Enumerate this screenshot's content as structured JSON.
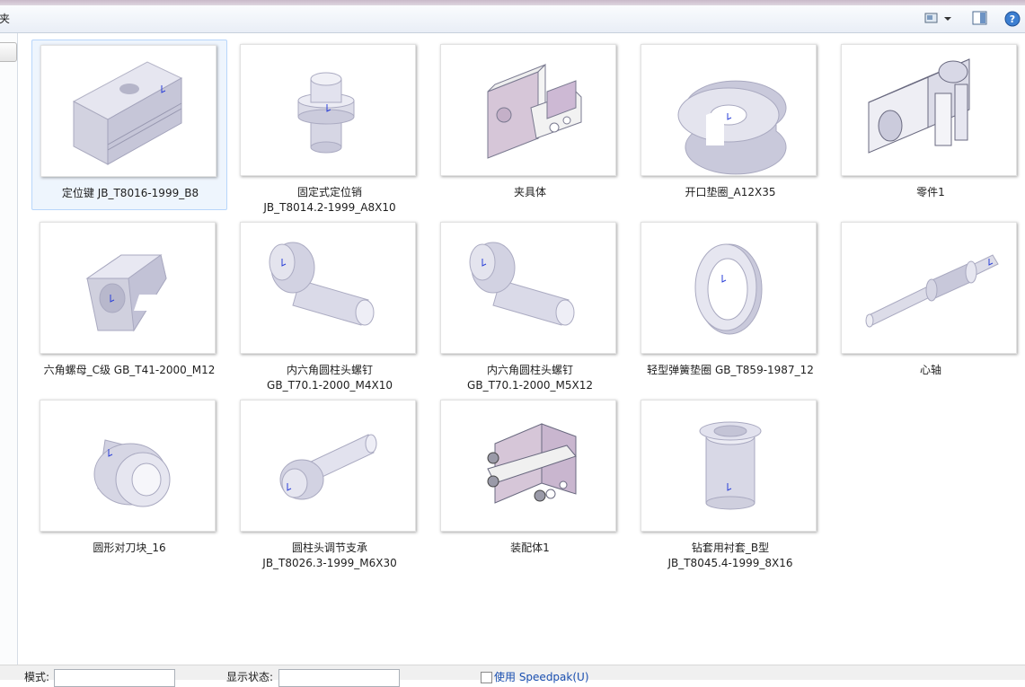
{
  "toolbar": {
    "crumb": "夹",
    "icons": [
      "view-icon",
      "dropdown-arrow-icon",
      "preview-pane-icon",
      "help-icon"
    ]
  },
  "tiles": [
    {
      "label": "定位键 JB_T8016-1999_B8",
      "selected": true
    },
    {
      "label": "固定式定位销\nJB_T8014.2-1999_A8X10"
    },
    {
      "label": "夹具体"
    },
    {
      "label": "开口垫圈_A12X35"
    },
    {
      "label": "零件1"
    },
    {
      "label": "六角螺母_C级 GB_T41-2000_M12"
    },
    {
      "label": "内六角圆柱头螺钉\nGB_T70.1-2000_M4X10"
    },
    {
      "label": "内六角圆柱头螺钉\nGB_T70.1-2000_M5X12"
    },
    {
      "label": "轻型弹簧垫圈 GB_T859-1987_12"
    },
    {
      "label": "心轴"
    },
    {
      "label": "圆形对刀块_16"
    },
    {
      "label": "圆柱头调节支承\nJB_T8026.3-1999_M6X30"
    },
    {
      "label": "装配体1"
    },
    {
      "label": "钻套用衬套_B型\nJB_T8045.4-1999_8X16"
    }
  ],
  "statusbar": {
    "mode_label": "模式:",
    "display_label": "显示状态:",
    "speedpak_label": "使用 Speedpak(U)"
  }
}
